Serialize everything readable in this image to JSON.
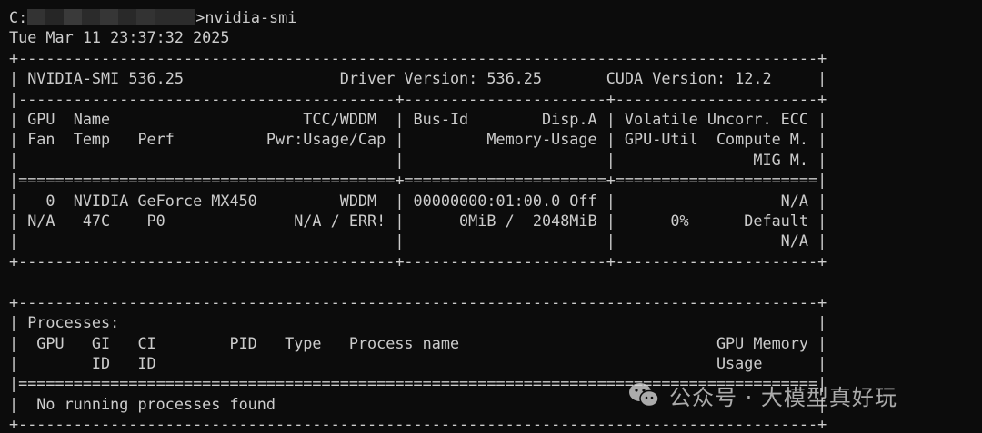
{
  "prompt": {
    "drive_prefix": "C:",
    "command": ">nvidia-smi"
  },
  "timestamp": "Tue Mar 11 23:37:32 2025",
  "smi_output": [
    "+---------------------------------------------------------------------------------------+",
    "| NVIDIA-SMI 536.25                 Driver Version: 536.25       CUDA Version: 12.2     |",
    "|-----------------------------------------+----------------------+----------------------+",
    "| GPU  Name                     TCC/WDDM  | Bus-Id        Disp.A | Volatile Uncorr. ECC |",
    "| Fan  Temp   Perf          Pwr:Usage/Cap |         Memory-Usage | GPU-Util  Compute M. |",
    "|                                         |                      |               MIG M. |",
    "|=========================================+======================+======================|",
    "|   0  NVIDIA GeForce MX450         WDDM  | 00000000:01:00.0 Off |                  N/A |",
    "| N/A   47C    P0              N/A / ERR! |      0MiB /  2048MiB |      0%      Default |",
    "|                                         |                      |                  N/A |",
    "+-----------------------------------------+----------------------+----------------------+",
    "",
    "+---------------------------------------------------------------------------------------+",
    "| Processes:                                                                            |",
    "|  GPU   GI   CI        PID   Type   Process name                            GPU Memory |",
    "|        ID   ID                                                             Usage      |",
    "|=======================================================================================|",
    "|  No running processes found                                                           |",
    "+---------------------------------------------------------------------------------------+"
  ],
  "watermark": {
    "text": "公众号 · 大模型真好玩",
    "icon": "wechat-icon"
  },
  "colors": {
    "background": "#0c0c0c",
    "foreground": "#cccccc"
  }
}
